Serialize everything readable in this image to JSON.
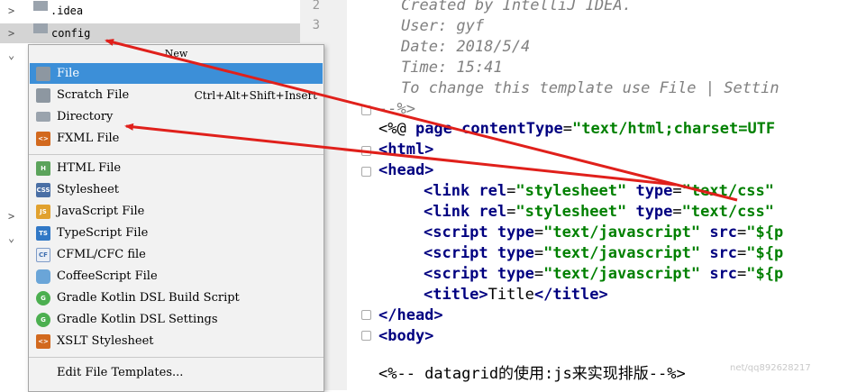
{
  "tree": {
    "rows": [
      {
        "label": ".idea",
        "arrow": ">"
      },
      {
        "label": "config",
        "arrow": ">"
      },
      {
        "arrow": "⌄"
      },
      {
        "arrow": ">"
      },
      {
        "arrow": "⌄"
      }
    ]
  },
  "gutter": {
    "lines": [
      "2",
      "3"
    ]
  },
  "code": {
    "c1": "Created by IntelliJ IDEA.",
    "c2": "User: gyf",
    "c3": "Date: 2018/5/4",
    "c4": "Time: 15:41",
    "c5": "To change this template use File | Settin",
    "c6": "--%>",
    "l7a": "<%@ ",
    "l7b": "page ",
    "l7c": "contentType",
    "l7d": "=",
    "l7e": "\"text/html;charset=UTF",
    "l8": "<html>",
    "l9": "<head>",
    "l10a": "<link ",
    "l10b": "rel",
    "l10c": "=",
    "l10d": "\"stylesheet\"",
    "l10e": " type",
    "l10f": "=",
    "l10g": "\"text/css\"",
    "l11a": "<link ",
    "l11b": "rel",
    "l11c": "=",
    "l11d": "\"stylesheet\"",
    "l11e": " type",
    "l11f": "=",
    "l11g": "\"text/css\"",
    "l12a": "<script ",
    "l12b": "type",
    "l12c": "=",
    "l12d": "\"text/javascript\"",
    "l12e": " src",
    "l12f": "=",
    "l12g": "\"${p",
    "l13a": "<script ",
    "l13b": "type",
    "l13c": "=",
    "l13d": "\"text/javascript\"",
    "l13e": " src",
    "l13f": "=",
    "l13g": "\"${p",
    "l14a": "<script ",
    "l14b": "type",
    "l14c": "=",
    "l14d": "\"text/javascript\"",
    "l14e": " src",
    "l14f": "=",
    "l14g": "\"${p",
    "l15a": "<title>",
    "l15b": "Title",
    "l15c": "</title>",
    "l16": "</head>",
    "l17": "<body>",
    "l18": "<%-- datagrid的使用:js来实现排版--%>"
  },
  "menu": {
    "title": "New",
    "items": [
      {
        "label": "File",
        "selected": true,
        "icon": "file-icon"
      },
      {
        "label": "Scratch File",
        "shortcut": "Ctrl+Alt+Shift+Insert",
        "icon": "scratch-file-icon"
      },
      {
        "label": "Directory",
        "icon": "folder-icon"
      },
      {
        "label": "FXML File",
        "icon": "fxml-icon",
        "icon_text": "<>"
      },
      {
        "label": "HTML File",
        "icon": "html-icon",
        "icon_text": "H"
      },
      {
        "label": "Stylesheet",
        "icon": "css-icon",
        "icon_text": "CSS"
      },
      {
        "label": "JavaScript File",
        "icon": "js-icon",
        "icon_text": "JS"
      },
      {
        "label": "TypeScript File",
        "icon": "ts-icon",
        "icon_text": "TS"
      },
      {
        "label": "CFML/CFC file",
        "icon": "cf-icon",
        "icon_text": "CF"
      },
      {
        "label": "CoffeeScript File",
        "icon": "coffee-icon"
      },
      {
        "label": "Gradle Kotlin DSL Build Script",
        "icon": "gradle-icon",
        "icon_text": "G"
      },
      {
        "label": "Gradle Kotlin DSL Settings",
        "icon": "gradle-icon",
        "icon_text": "G"
      },
      {
        "label": "XSLT Stylesheet",
        "icon": "xslt-icon",
        "icon_text": "<>"
      },
      {
        "label": "Edit File Templates..."
      }
    ]
  },
  "watermark": "net/qq892628217",
  "colors": {
    "selection": "#3c8fd8",
    "annotation_arrow": "#e0201b"
  }
}
